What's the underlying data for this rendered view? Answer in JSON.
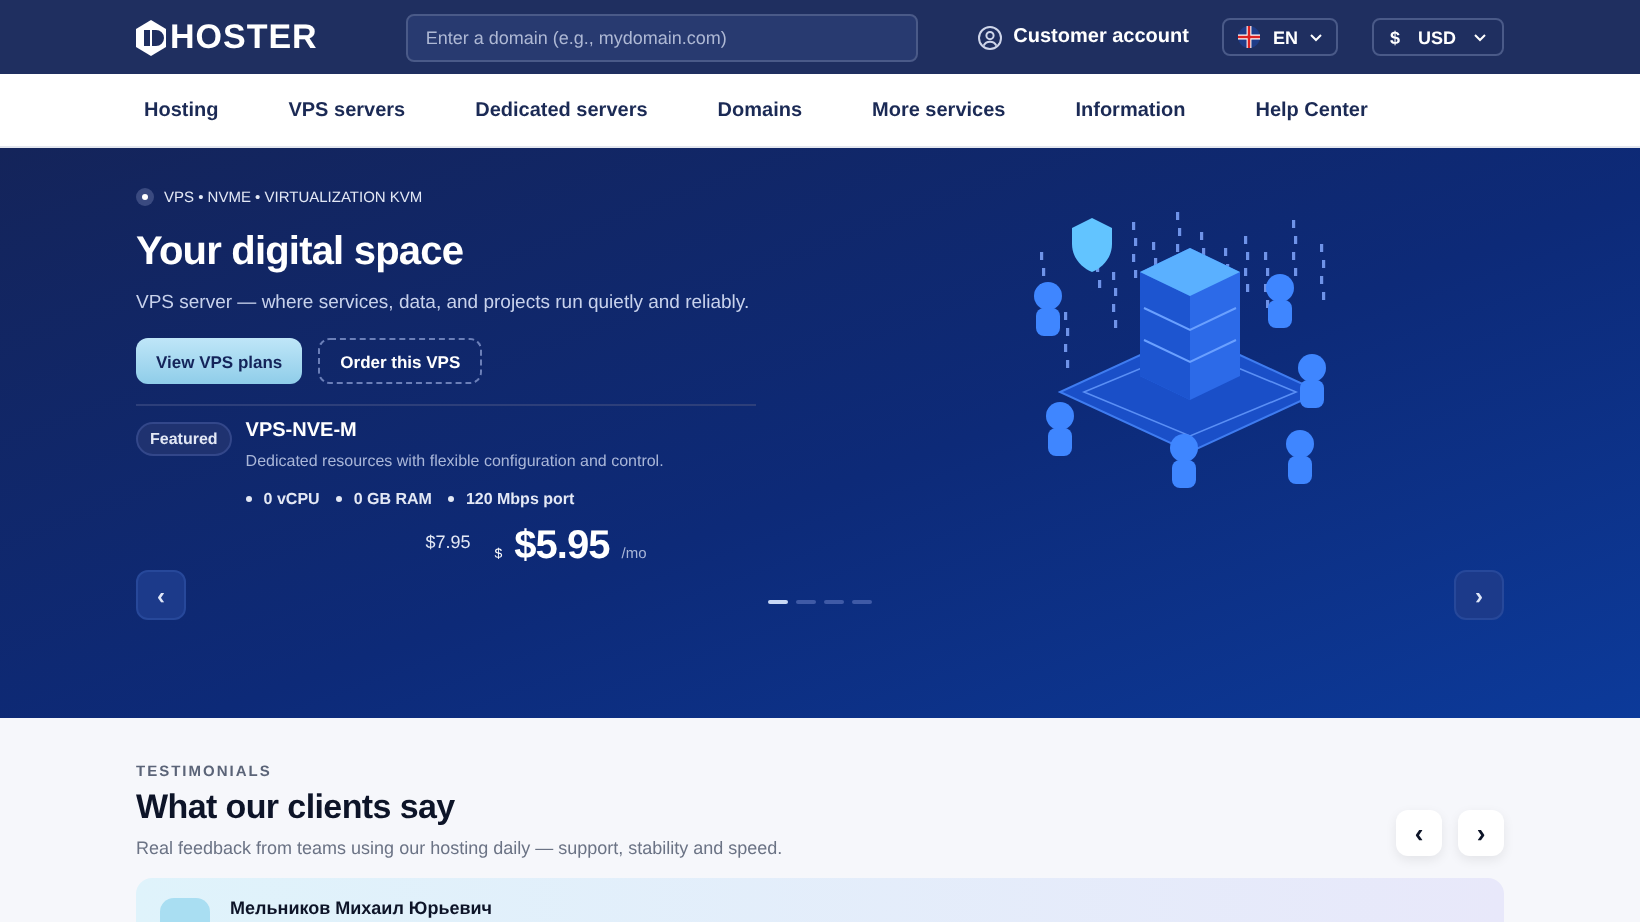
{
  "header": {
    "logo": "HOSTER",
    "search": {
      "placeholder": "Enter a domain (e.g., mydomain.com)"
    },
    "account": "Customer account",
    "language": "EN",
    "currency_symbol": "$",
    "currency": "USD"
  },
  "nav": [
    "Hosting",
    "VPS servers",
    "Dedicated servers",
    "Domains",
    "More services",
    "Information",
    "Help Center"
  ],
  "hero": {
    "eyebrow": "VPS • NVME • VIRTUALIZATION KVM",
    "title": "Your digital space",
    "subtitle": "VPS server — where services, data, and projects run quietly and reliably.",
    "buttons": [
      {
        "label": "View VPS plans",
        "kind": "primary"
      },
      {
        "label": "Order this VPS",
        "kind": "outline"
      }
    ],
    "plan": {
      "badge": "Featured",
      "name": "VPS-NVE-M",
      "description": "Dedicated resources with flexible configuration and control.",
      "specs": [
        "0 vCPU",
        "0 GB RAM",
        "120 Mbps port"
      ],
      "old_price": "$7.95",
      "currency": "$",
      "price": "$5.95",
      "period": "/mo"
    },
    "prev": "‹",
    "next": "›",
    "dots": [
      {
        "selected": true
      },
      {
        "selected": false
      },
      {
        "selected": false
      },
      {
        "selected": false
      }
    ]
  },
  "testimonials": {
    "eyebrow": "TESTIMONIALS",
    "title": "What our clients say",
    "subtitle": "Real feedback from teams using our hosting daily — support, stability and speed.",
    "prev": "‹",
    "next": "›",
    "author": "Мельников Михаил Юрьевич"
  }
}
